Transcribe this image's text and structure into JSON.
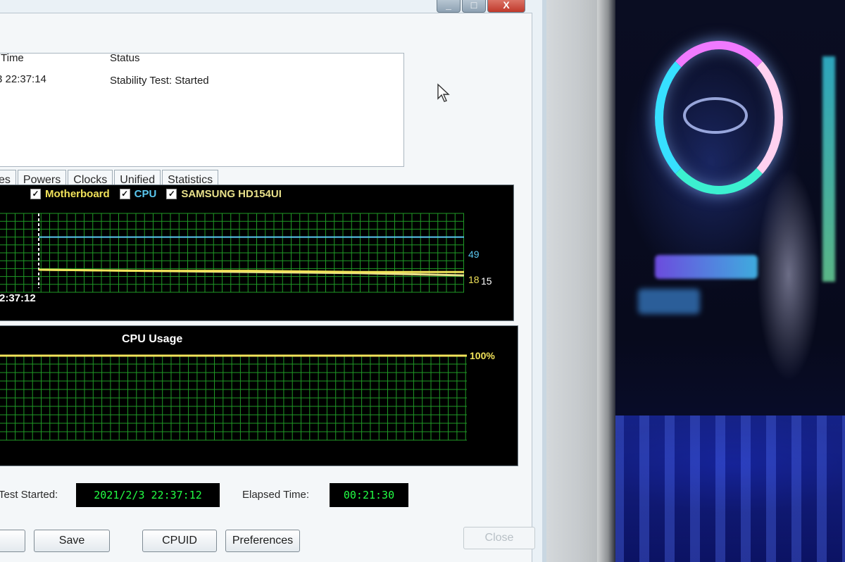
{
  "window": {
    "controls": {
      "minimize": "_",
      "maximize": "□",
      "close": "X"
    }
  },
  "log": {
    "columns": [
      "Time",
      "Status"
    ],
    "rows": [
      {
        "time": "3 22:37:14",
        "status": "Stability Test: Started"
      }
    ]
  },
  "tabs": [
    "es",
    "Powers",
    "Clocks",
    "Unified",
    "Statistics"
  ],
  "temperature_graph": {
    "legend": [
      {
        "label": "Motherboard",
        "color": "#f2e35a",
        "checked": true
      },
      {
        "label": "CPU",
        "color": "#5ac8f0",
        "checked": true
      },
      {
        "label": "SAMSUNG HD154UI",
        "color": "#e8e08a",
        "checked": true
      }
    ],
    "time_label": "2:37:12",
    "values": {
      "cpu": "49",
      "motherboard": "18",
      "drive": "15"
    }
  },
  "usage_graph": {
    "title": "CPU Usage",
    "value_label": "100%",
    "value": 100
  },
  "chart_data": [
    {
      "type": "line",
      "series": [
        {
          "name": "CPU",
          "values": [
            49,
            49,
            49,
            49,
            49
          ]
        },
        {
          "name": "Motherboard",
          "values": [
            20,
            19,
            19,
            18,
            18
          ]
        },
        {
          "name": "SAMSUNG HD154UI",
          "values": [
            20,
            19,
            18,
            17,
            15
          ]
        }
      ],
      "xlabel": "2:37:12",
      "color_cpu": "#5ac8f0",
      "color_mb": "#f2e35a",
      "color_hdd": "#e8e08a"
    },
    {
      "type": "line",
      "title": "CPU Usage",
      "series": [
        {
          "values": [
            100,
            100,
            100,
            100,
            100
          ]
        }
      ],
      "ylim": [
        0,
        100
      ],
      "color": "#f2e35a"
    }
  ],
  "footer": {
    "test_started_label": "Test Started:",
    "test_started_value": "2021/2/3 22:37:12",
    "elapsed_label": "Elapsed Time:",
    "elapsed_value": "00:21:30"
  },
  "buttons": {
    "save": "Save",
    "cpuid": "CPUID",
    "preferences": "Preferences",
    "close": "Close"
  }
}
